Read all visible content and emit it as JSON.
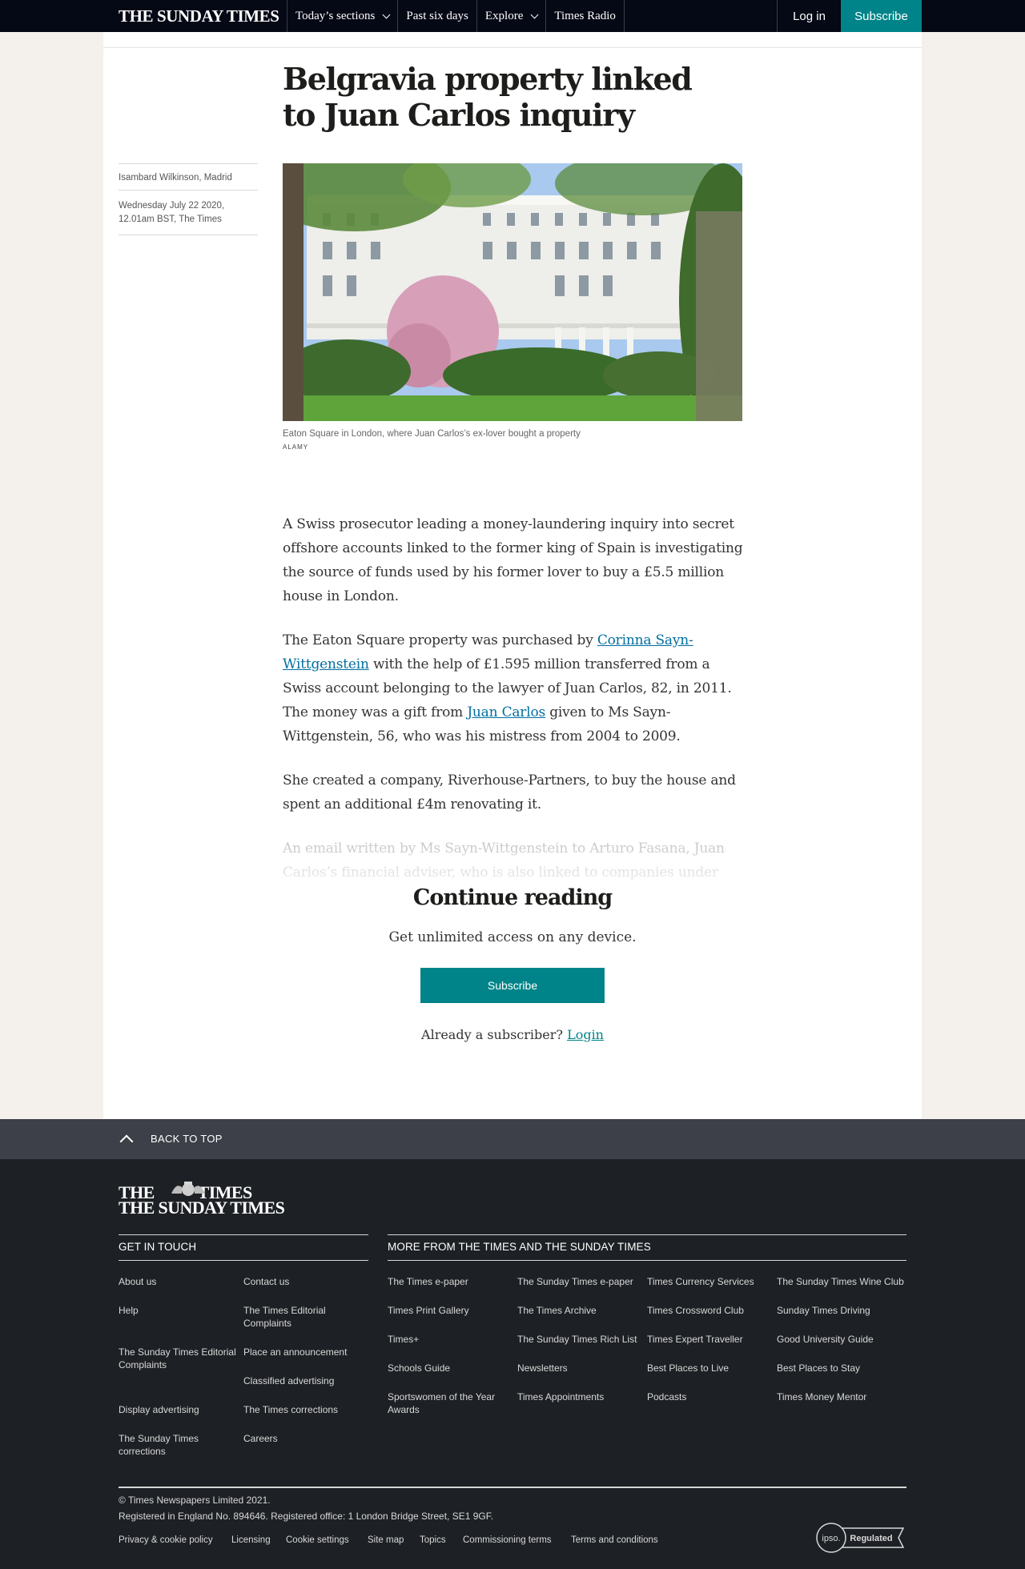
{
  "nav": {
    "brand": "THE SUNDAY TIMES",
    "links": [
      "Today’s sections",
      "Past six days",
      "Explore",
      "Times Radio"
    ],
    "login": "Log in",
    "subscribe": "Subscribe"
  },
  "article": {
    "headline": "Belgravia property linked to Juan Carlos inquiry",
    "author": "Isambard Wilkinson, Madrid",
    "date_line1": "Wednesday July 22 2020,",
    "date_line2": "12.01am BST, The Times",
    "caption": "Eaton Square in London, where Juan Carlos’s ex-lover bought a property",
    "credit": "ALAMY",
    "p1": "A Swiss prosecutor leading a money-laundering inquiry into secret offshore accounts linked to the former king of Spain is investigating the source of funds used by his former lover to buy a £5.5 million house in London.",
    "p2_a": "The Eaton Square property was purchased by ",
    "p2_link1": "Corinna Sayn-Wittgenstein",
    "p2_b": " with the help of £1.595 million transferred from a Swiss account belonging to the lawyer of Juan Carlos, 82, in 2011. The money was a gift from ",
    "p2_link2": "Juan Carlos",
    "p2_c": " given to Ms Sayn-Wittgenstein, 56, who was his mistress from 2004 to 2009.",
    "p3": "She created a company, Riverhouse-Partners, to buy the house and spent an additional £4m renovating it.",
    "p4": "An email written by Ms Sayn-Wittgenstein to Arturo Fasana, Juan Carlos’s financial adviser, who is also linked to companies under"
  },
  "paywall": {
    "title": "Continue reading",
    "subtitle": "Get unlimited access on any device.",
    "button": "Subscribe",
    "already": "Already a subscriber? ",
    "login": "Login"
  },
  "backtop": "BACK TO TOP",
  "footer": {
    "logo1": "THE TIMES",
    "logo1_the": "THE",
    "logo2": "THE SUNDAY TIMES",
    "get_in_touch": "GET IN TOUCH",
    "more_from": "MORE FROM THE TIMES AND THE SUNDAY TIMES",
    "touch_col1": [
      "About us",
      "Help",
      "The Sunday Times Editorial Complaints",
      "Display advertising",
      "The Sunday Times corrections"
    ],
    "touch_col2": [
      "Contact us",
      "The Times Editorial Complaints",
      "Place an announcement",
      "Classified advertising",
      "The Times corrections",
      "Careers"
    ],
    "more_col1": [
      "The Times e-paper",
      "Times Print Gallery",
      "Times+",
      "Schools Guide",
      "Sportswomen of the Year Awards"
    ],
    "more_col2": [
      "The Sunday Times e-paper",
      "The Times Archive",
      "The Sunday Times Rich List",
      "Newsletters",
      "Times Appointments"
    ],
    "more_col3": [
      "Times Currency Services",
      "Times Crossword Club",
      "Times Expert Traveller",
      "Best Places to Live",
      "Podcasts"
    ],
    "more_col4": [
      "The Sunday Times Wine Club",
      "Sunday Times Driving",
      "Good University Guide",
      "Best Places to Stay",
      "Times Money Mentor"
    ],
    "copyright": "© Times Newspapers Limited 2021.",
    "registered": "Registered in England No. 894646. Registered office: 1 London Bridge Street, SE1 9GF.",
    "legal": [
      "Privacy & cookie policy",
      "Licensing",
      "Cookie settings",
      "Site map",
      "Topics",
      "Commissioning terms",
      "Terms and conditions"
    ],
    "ipso_mark": "ipso.",
    "ipso_label": "Regulated"
  }
}
